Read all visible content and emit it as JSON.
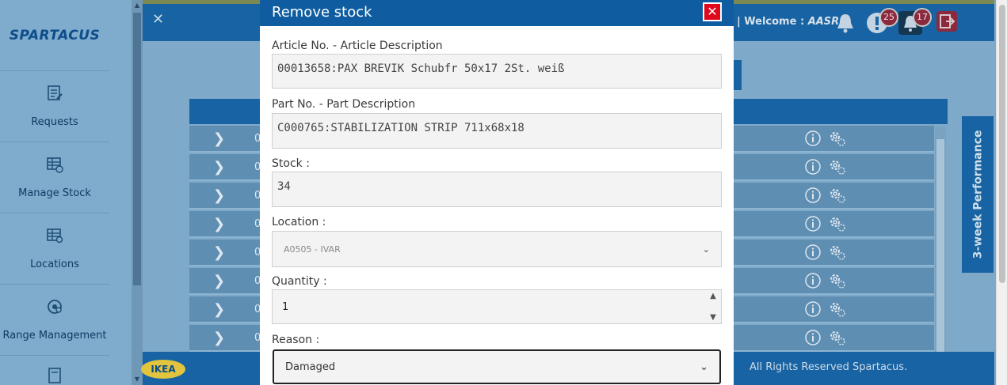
{
  "app": {
    "logo_text": "SPARTACUS"
  },
  "sidebar": {
    "items": [
      {
        "label": "Requests",
        "icon": "requests-icon"
      },
      {
        "label": "Manage Stock",
        "icon": "manage-stock-icon"
      },
      {
        "label": "Locations",
        "icon": "locations-icon"
      },
      {
        "label": "Range Management",
        "icon": "range-management-icon"
      },
      {
        "label": "",
        "icon": "report-icon"
      }
    ]
  },
  "header": {
    "close_glyph": "✕",
    "welcome_prefix": "| Welcome :",
    "user": "AASRI",
    "alerts_count": "25",
    "notifications_count": "17"
  },
  "background_table": {
    "rows": [
      "0",
      "0",
      "0",
      "0",
      "0",
      "0",
      "0",
      "0"
    ]
  },
  "side_tab": {
    "label": "3-week Performance"
  },
  "footer": {
    "logo_text": "IKEA",
    "rights": "All Rights Reserved Spartacus."
  },
  "modal": {
    "title": "Remove stock",
    "close_glyph": "✕",
    "article_label": "Article No. - Article Description",
    "article_value": "00013658:PAX BREVIK Schubfr 50x17 2St. weiß",
    "part_label": "Part No. - Part Description",
    "part_value": "C000765:STABILIZATION STRIP 711x68x18",
    "stock_label": "Stock :",
    "stock_value": "34",
    "location_label": "Location :",
    "location_value": "A0505 - IVAR",
    "quantity_label": "Quantity :",
    "quantity_value": "1",
    "reason_label": "Reason :",
    "reason_value": "Damaged"
  },
  "colors": {
    "brand_blue": "#1763a3",
    "close_red": "#e0081b",
    "badge": "#8b2a3d"
  }
}
